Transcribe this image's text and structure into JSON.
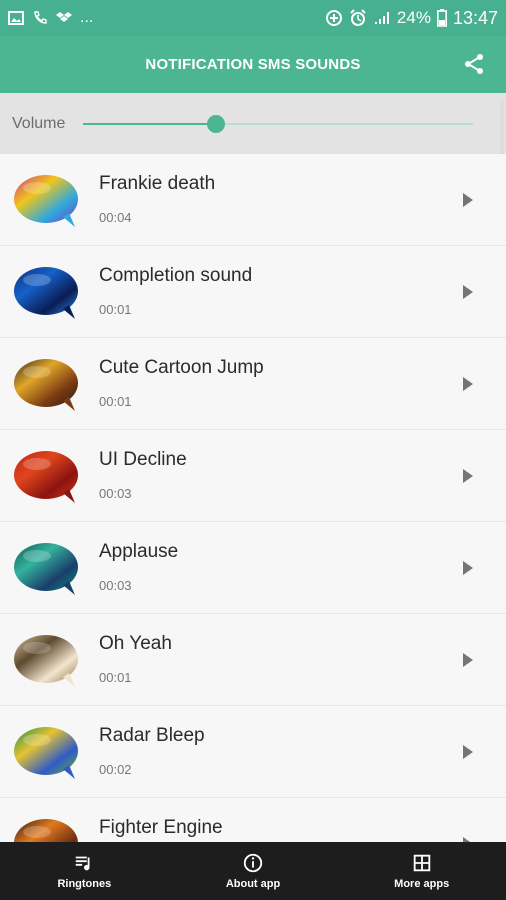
{
  "status_bar": {
    "left_icons": [
      "image-icon",
      "phone-icon",
      "dropbox-icon"
    ],
    "more": "...",
    "right_icons": [
      "data-saver-icon",
      "alarm-icon",
      "signal-icon"
    ],
    "battery": "24%",
    "time": "13:47"
  },
  "app_bar": {
    "title": "NOTIFICATION SMS SOUNDS",
    "share_icon": "share-icon"
  },
  "volume": {
    "label": "Volume",
    "level": 0.34
  },
  "sounds": [
    {
      "title": "Frankie death",
      "duration": "00:04",
      "thumb_colors": [
        "#d23a86",
        "#f0c51a",
        "#2fa7e0",
        "#7a3db5"
      ]
    },
    {
      "title": "Completion sound",
      "duration": "00:01",
      "thumb_colors": [
        "#0b2f7a",
        "#1661c8",
        "#0a1d55",
        "#2a86e0"
      ]
    },
    {
      "title": "Cute Cartoon Jump",
      "duration": "00:01",
      "thumb_colors": [
        "#3a2a1a",
        "#e0a629",
        "#7b3b12",
        "#2a1a10"
      ]
    },
    {
      "title": "UI Decline",
      "duration": "00:03",
      "thumb_colors": [
        "#c0251b",
        "#e0451c",
        "#8b1410",
        "#d03320"
      ]
    },
    {
      "title": "Applause",
      "duration": "00:03",
      "thumb_colors": [
        "#0e5a55",
        "#34b29e",
        "#1a3e6a",
        "#0c8b7b"
      ]
    },
    {
      "title": "Oh Yeah",
      "duration": "00:01",
      "thumb_colors": [
        "#d9c3a0",
        "#5e4a2e",
        "#f2e5cf",
        "#8e744c"
      ]
    },
    {
      "title": "Radar Bleep",
      "duration": "00:02",
      "thumb_colors": [
        "#1d8d4a",
        "#e6c332",
        "#2f5bc7",
        "#6ab62f"
      ]
    },
    {
      "title": "Fighter Engine",
      "duration": "",
      "thumb_colors": [
        "#301a10",
        "#e37a21",
        "#6b2c10",
        "#f2a22a"
      ]
    }
  ],
  "bottom_nav": [
    {
      "label": "Ringtones",
      "icon": "playlist-icon"
    },
    {
      "label": "About app",
      "icon": "info-icon"
    },
    {
      "label": "More apps",
      "icon": "grid-icon"
    }
  ],
  "colors": {
    "accent": "#4bb691",
    "status": "#47b08e",
    "nav_bg": "#1d1d1d"
  }
}
